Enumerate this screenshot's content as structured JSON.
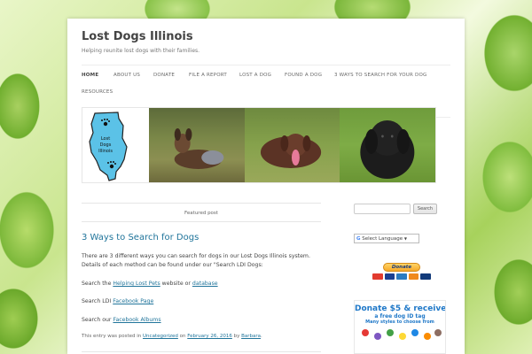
{
  "site": {
    "title": "Lost Dogs Illinois",
    "tagline": "Helping reunite lost dogs with their families."
  },
  "nav": {
    "items": [
      {
        "label": "HOME",
        "active": true
      },
      {
        "label": "ABOUT US"
      },
      {
        "label": "DONATE"
      },
      {
        "label": "FILE A REPORT"
      },
      {
        "label": "LOST A DOG"
      },
      {
        "label": "FOUND A DOG"
      },
      {
        "label": "3 WAYS TO SEARCH FOR YOUR DOG"
      },
      {
        "label": "RESOURCES"
      }
    ]
  },
  "banner": {
    "logo_text": "Lost Dogs Illinois"
  },
  "featured": {
    "label": "Featured post"
  },
  "post": {
    "title": "3 Ways to Search for Dogs",
    "intro": "There are 3 different ways you can search for dogs in our Lost Dogs Illinois system. Details of each method can be found under our \"Search LDI Dogs:",
    "line1_prefix": "Search the ",
    "line1_link1": "Helping Lost Pets",
    "line1_mid": " website or ",
    "line1_link2": "database",
    "line2_prefix": "Search LDI ",
    "line2_link": "Facebook Page",
    "line3_prefix": "Search our ",
    "line3_link": "Facebook Albums",
    "meta_prefix": "This entry was posted in ",
    "meta_category": "Uncategorized",
    "meta_on": " on ",
    "meta_date": "February 26, 2016",
    "meta_by": " by ",
    "meta_author": "Barbara",
    "meta_end": "."
  },
  "sidebar": {
    "search_button": "Search",
    "translate_label": "Select Language",
    "translate_caret": "▼",
    "donate_button": "Donate",
    "promo_line1": "Donate $5 & receive",
    "promo_line2": "a free dog ID tag",
    "promo_line3": "Many styles to choose from"
  },
  "colors": {
    "link": "#21759b",
    "promo_blue": "#1f78c8"
  }
}
